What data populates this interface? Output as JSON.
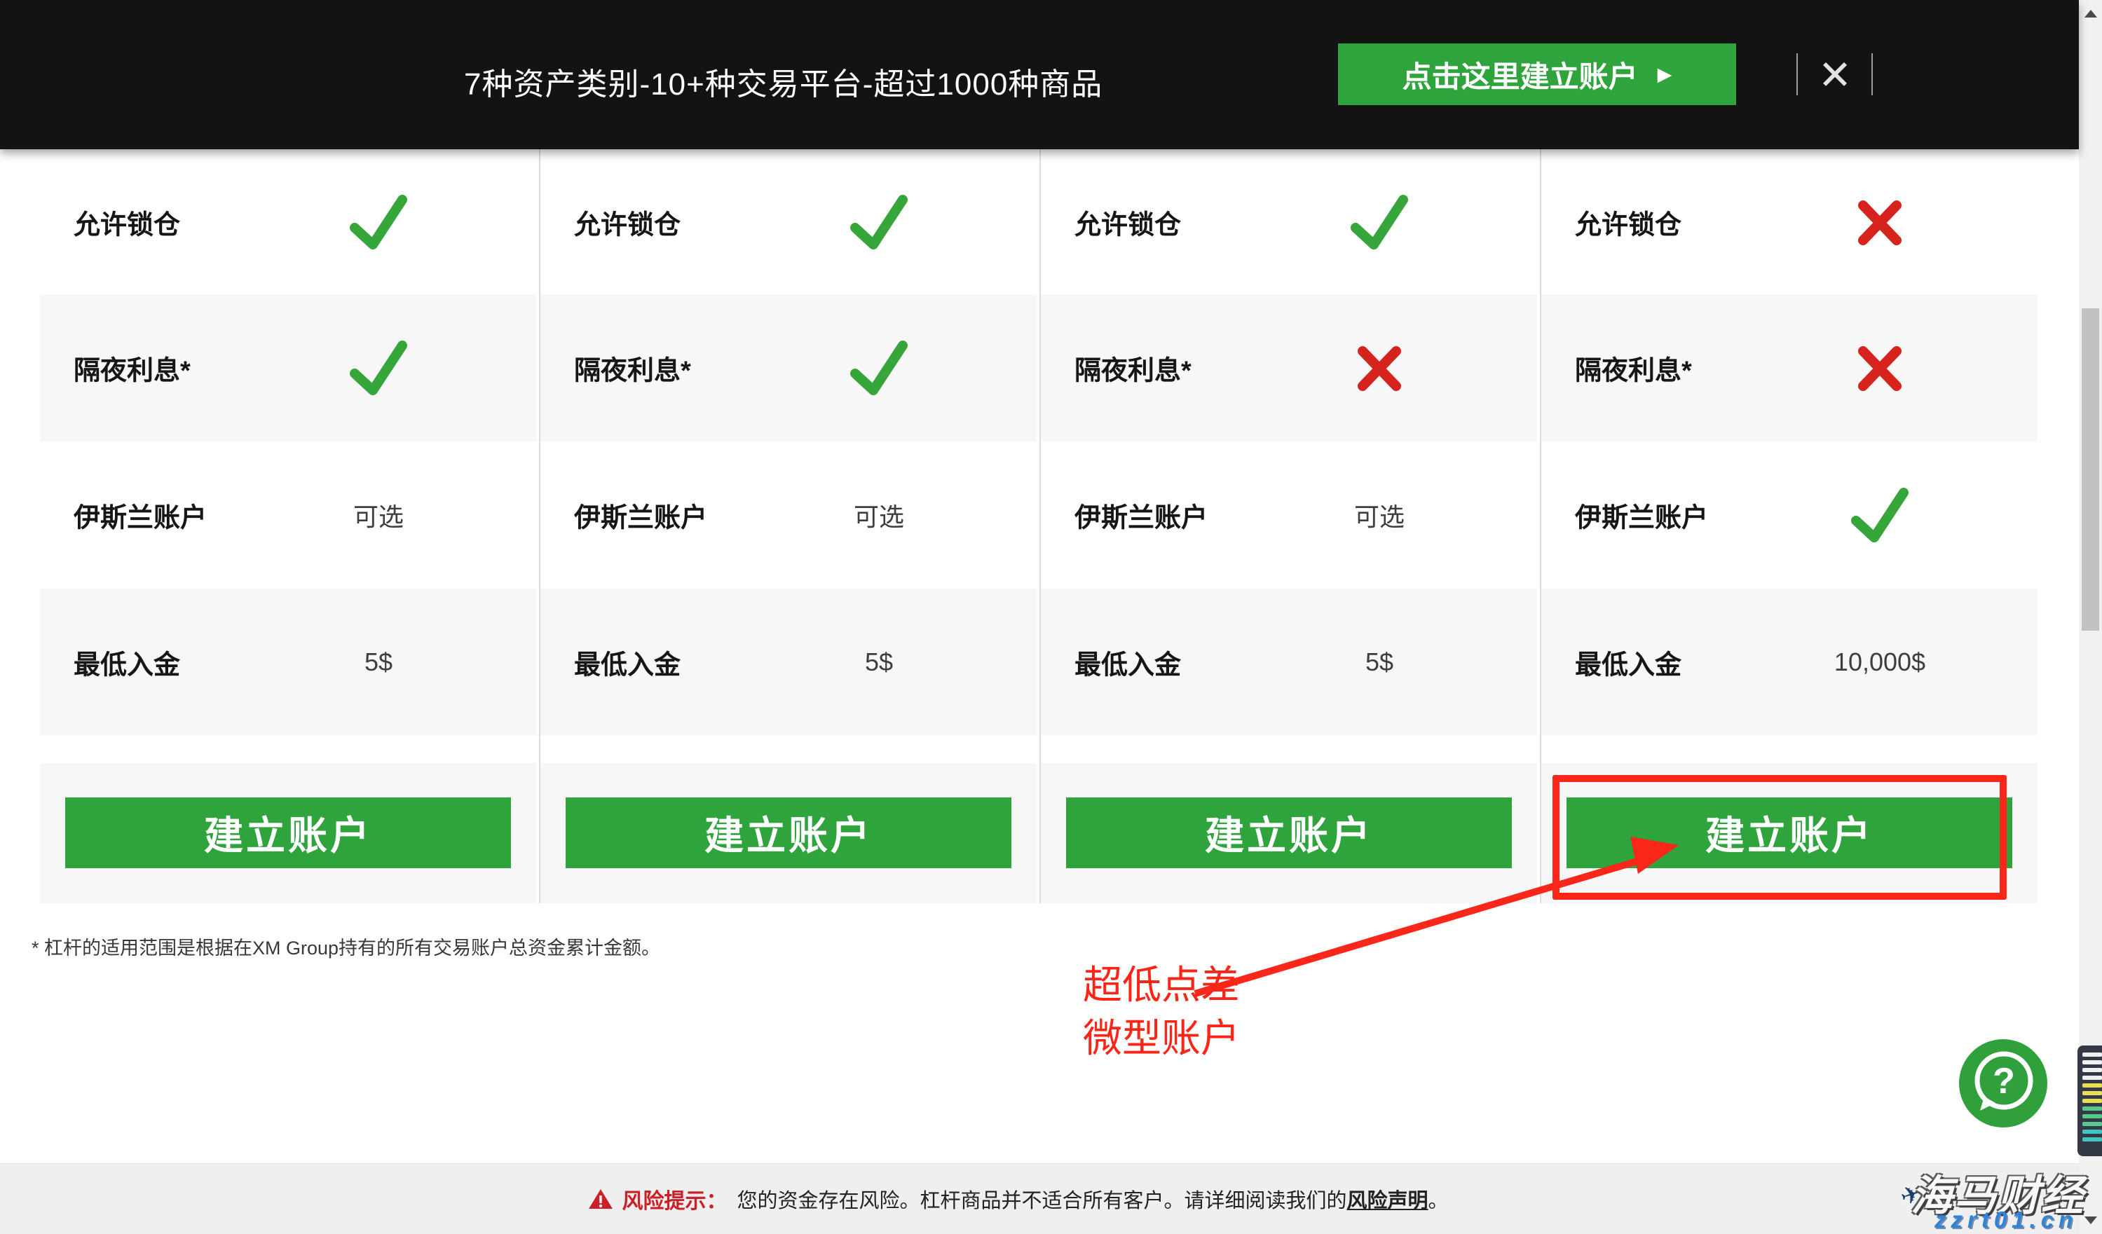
{
  "topbar": {
    "title": "7种资产类别-10+种交易平台-超过1000种商品",
    "cta_label": "点击这里建立账户",
    "cta_arrow": "▶",
    "close_glyph": "✕"
  },
  "table": {
    "columns": [
      {
        "rows": [
          {
            "label": "允许锁仓",
            "kind": "check"
          },
          {
            "label": "隔夜利息*",
            "kind": "check"
          },
          {
            "label": "伊斯兰账户",
            "kind": "text",
            "text": "可选"
          },
          {
            "label": "最低入金",
            "kind": "text",
            "text": "5$"
          }
        ],
        "button": "建立账户"
      },
      {
        "rows": [
          {
            "label": "允许锁仓",
            "kind": "check"
          },
          {
            "label": "隔夜利息*",
            "kind": "check"
          },
          {
            "label": "伊斯兰账户",
            "kind": "text",
            "text": "可选"
          },
          {
            "label": "最低入金",
            "kind": "text",
            "text": "5$"
          }
        ],
        "button": "建立账户"
      },
      {
        "rows": [
          {
            "label": "允许锁仓",
            "kind": "check"
          },
          {
            "label": "隔夜利息*",
            "kind": "cross"
          },
          {
            "label": "伊斯兰账户",
            "kind": "text",
            "text": "可选"
          },
          {
            "label": "最低入金",
            "kind": "text",
            "text": "5$"
          }
        ],
        "button": "建立账户"
      },
      {
        "rows": [
          {
            "label": "允许锁仓",
            "kind": "cross"
          },
          {
            "label": "隔夜利息*",
            "kind": "cross"
          },
          {
            "label": "伊斯兰账户",
            "kind": "check"
          },
          {
            "label": "最低入金",
            "kind": "text",
            "text": "10,000$"
          }
        ],
        "button": "建立账户"
      }
    ]
  },
  "footnote": "* 杠杆的适用范围是根据在XM Group持有的所有交易账户总资金累计金额。",
  "annotation": {
    "line1": "超低点差",
    "line2": "微型账户"
  },
  "footer": {
    "warning_label": "风险提示：",
    "body": "您的资金存在风险。杠杆商品并不适合所有客户。请详细阅读我们的",
    "link_text": "风险声明",
    "suffix": "。"
  },
  "help": {
    "glyph": "?"
  },
  "watermark": {
    "title": "海马财经",
    "url": "zzrt01.cn",
    "plane_glyph": "✈"
  },
  "colors": {
    "button_green": "#2fa33c",
    "check_green": "#36a63b",
    "cross_red": "#d6231e",
    "highlight_red": "#f8271a",
    "warning_red": "#ca2026",
    "topbar_black": "#131313",
    "footer_gray": "#efefef",
    "watermark_blue": "#2f83d8"
  }
}
